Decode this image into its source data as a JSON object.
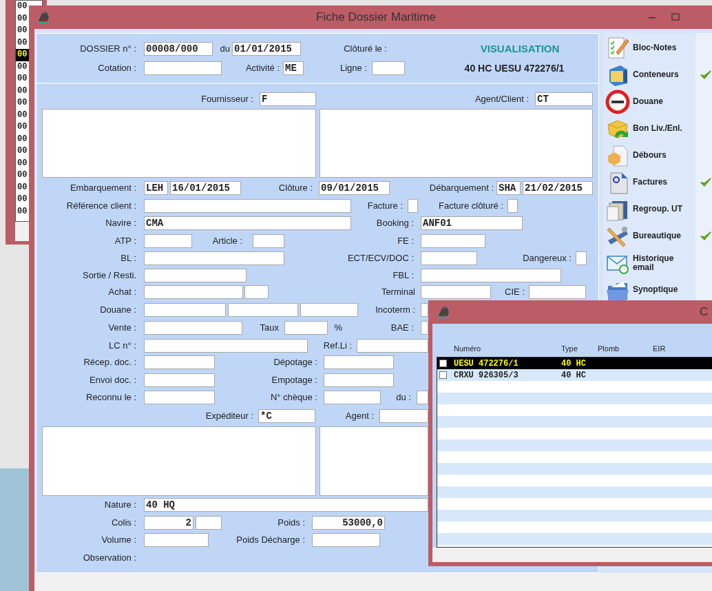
{
  "background_window": {
    "cells": [
      {
        "text": "00",
        "selected": false
      },
      {
        "text": "00",
        "selected": false
      },
      {
        "text": "00",
        "selected": false
      },
      {
        "text": "00",
        "selected": false
      },
      {
        "text": "00",
        "selected": true
      },
      {
        "text": "00",
        "selected": false
      },
      {
        "text": "00",
        "selected": false
      },
      {
        "text": "00",
        "selected": false
      },
      {
        "text": "00",
        "selected": false
      },
      {
        "text": "00",
        "selected": false
      },
      {
        "text": "00",
        "selected": false
      },
      {
        "text": "00",
        "selected": false
      },
      {
        "text": "00",
        "selected": false
      },
      {
        "text": "00",
        "selected": false
      },
      {
        "text": "00",
        "selected": false
      },
      {
        "text": "00",
        "selected": false
      },
      {
        "text": "00",
        "selected": false
      },
      {
        "text": "00",
        "selected": false
      }
    ]
  },
  "window": {
    "title": "Fiche Dossier Maritime"
  },
  "form_rows": [
    {
      "items": [
        {
          "kind": "label",
          "text": "DOSSIER n° :"
        },
        {
          "kind": "field",
          "value": "00008/000"
        },
        {
          "kind": "label",
          "text": "du"
        },
        {
          "kind": "field",
          "value": "01/01/2015"
        },
        {
          "kind": "label",
          "text": "Clôturé le :"
        },
        {
          "kind": "status",
          "text": "VISUALISATION"
        }
      ]
    },
    {
      "items": [
        {
          "kind": "label",
          "text": "Cotation :"
        },
        {
          "kind": "field"
        },
        {
          "kind": "label",
          "text": "Activité :"
        },
        {
          "kind": "field",
          "value": "ME"
        },
        {
          "kind": "label",
          "text": "Ligne :"
        },
        {
          "kind": "field"
        },
        {
          "kind": "heading",
          "text": "40 HC UESU 472276/1"
        }
      ]
    },
    {
      "items": [
        {
          "kind": "label",
          "text": "Fournisseur :"
        },
        {
          "kind": "field",
          "value": "F"
        },
        {
          "kind": "label",
          "text": "Agent/Client :"
        },
        {
          "kind": "field",
          "value": "CT"
        }
      ]
    },
    {
      "items": [
        {
          "kind": "textarea"
        },
        {
          "kind": "textarea"
        }
      ]
    },
    {
      "items": [
        {
          "kind": "label",
          "text": "Embarquement :"
        },
        {
          "kind": "field",
          "value": "LEH"
        },
        {
          "kind": "field",
          "value": "16/01/2015"
        },
        {
          "kind": "label",
          "text": "Clôture :"
        },
        {
          "kind": "field",
          "value": "09/01/2015"
        },
        {
          "kind": "label",
          "text": "Débarquement :"
        },
        {
          "kind": "field",
          "value": "SHA"
        },
        {
          "kind": "field",
          "value": "21/02/2015"
        }
      ]
    },
    {
      "items": [
        {
          "kind": "label",
          "text": "Référence client :"
        },
        {
          "kind": "field"
        },
        {
          "kind": "label",
          "text": "Facture :"
        },
        {
          "kind": "checkbox",
          "checked": false
        },
        {
          "kind": "label",
          "text": "Facture clôturé :"
        },
        {
          "kind": "checkbox",
          "checked": false
        }
      ]
    },
    {
      "items": [
        {
          "kind": "label",
          "text": "Navire :"
        },
        {
          "kind": "field",
          "value": "CMA"
        },
        {
          "kind": "label",
          "text": "Booking :"
        },
        {
          "kind": "field",
          "value": "ANF01"
        }
      ]
    },
    {
      "items": [
        {
          "kind": "label",
          "text": "ATP :"
        },
        {
          "kind": "field"
        },
        {
          "kind": "label",
          "text": "Article :"
        },
        {
          "kind": "field"
        },
        {
          "kind": "label",
          "text": "FE :"
        },
        {
          "kind": "field"
        }
      ]
    },
    {
      "items": [
        {
          "kind": "label",
          "text": "BL :"
        },
        {
          "kind": "field"
        },
        {
          "kind": "label",
          "text": "ECT/ECV/DOC :"
        },
        {
          "kind": "field"
        },
        {
          "kind": "label",
          "text": "Dangereux :"
        },
        {
          "kind": "checkbox",
          "checked": false
        }
      ]
    },
    {
      "items": [
        {
          "kind": "label",
          "text": "Sortie / Resti."
        },
        {
          "kind": "field"
        },
        {
          "kind": "label",
          "text": "FBL :"
        },
        {
          "kind": "field"
        }
      ]
    },
    {
      "items": [
        {
          "kind": "label",
          "text": "Achat :"
        },
        {
          "kind": "field"
        },
        {
          "kind": "field"
        },
        {
          "kind": "label",
          "text": "Terminal"
        },
        {
          "kind": "field"
        },
        {
          "kind": "label",
          "text": "CIE :"
        },
        {
          "kind": "field"
        }
      ]
    },
    {
      "items": [
        {
          "kind": "label",
          "text": "Douane :"
        },
        {
          "kind": "field"
        },
        {
          "kind": "field"
        },
        {
          "kind": "field"
        },
        {
          "kind": "label",
          "text": "Incoterm :"
        },
        {
          "kind": "field"
        }
      ]
    },
    {
      "items": [
        {
          "kind": "label",
          "text": "Vente :"
        },
        {
          "kind": "field"
        },
        {
          "kind": "label",
          "text": "Taux"
        },
        {
          "kind": "field"
        },
        {
          "kind": "label",
          "text": "%"
        },
        {
          "kind": "label",
          "text": "BAE :"
        },
        {
          "kind": "field"
        }
      ]
    },
    {
      "items": [
        {
          "kind": "label",
          "text": "LC n° :"
        },
        {
          "kind": "field"
        },
        {
          "kind": "label",
          "text": "Ref.Li :"
        },
        {
          "kind": "field"
        }
      ]
    },
    {
      "items": [
        {
          "kind": "label",
          "text": "Récep. doc. :"
        },
        {
          "kind": "field"
        },
        {
          "kind": "label",
          "text": "Dépotage :"
        },
        {
          "kind": "field"
        }
      ]
    },
    {
      "items": [
        {
          "kind": "label",
          "text": "Envoi doc. :"
        },
        {
          "kind": "field"
        },
        {
          "kind": "label",
          "text": "Empotage :"
        },
        {
          "kind": "field"
        }
      ]
    },
    {
      "items": [
        {
          "kind": "label",
          "text": "Reconnu le :"
        },
        {
          "kind": "field"
        },
        {
          "kind": "label",
          "text": "N° chèque :"
        },
        {
          "kind": "field"
        },
        {
          "kind": "label",
          "text": "du :"
        },
        {
          "kind": "field"
        }
      ]
    },
    {
      "items": [
        {
          "kind": "label",
          "text": "Expéditeur :"
        },
        {
          "kind": "field",
          "value": "*C"
        },
        {
          "kind": "label",
          "text": "Agent :"
        },
        {
          "kind": "field"
        }
      ]
    },
    {
      "items": [
        {
          "kind": "textarea"
        },
        {
          "kind": "textarea"
        }
      ]
    },
    {
      "items": [
        {
          "kind": "label",
          "text": "Nature :"
        },
        {
          "kind": "field",
          "value": "40 HQ"
        }
      ]
    },
    {
      "items": [
        {
          "kind": "label",
          "text": "Colis :"
        },
        {
          "kind": "field",
          "value": "2"
        },
        {
          "kind": "field"
        },
        {
          "kind": "label",
          "text": "Poids :"
        },
        {
          "kind": "field",
          "value": "53000,0"
        }
      ]
    },
    {
      "items": [
        {
          "kind": "label",
          "text": "Volume :"
        },
        {
          "kind": "field"
        },
        {
          "kind": "label",
          "text": "Poids Décharge :"
        },
        {
          "kind": "field"
        }
      ]
    },
    {
      "items": [
        {
          "kind": "label",
          "text": "Observation :"
        }
      ]
    }
  ],
  "sidebar": {
    "items": [
      {
        "label": "Bloc-Notes",
        "done": false
      },
      {
        "label": "Conteneurs",
        "done": true
      },
      {
        "label": "Douane",
        "done": false
      },
      {
        "label": "Bon Liv./Enl.",
        "done": false
      },
      {
        "label": "Débours",
        "done": false
      },
      {
        "label": "Factures",
        "done": true
      },
      {
        "label": "Regroup. UT",
        "done": false
      },
      {
        "label": "Bureautique",
        "done": true
      },
      {
        "label": "Historique email",
        "done": false
      },
      {
        "label": "Synoptique",
        "done": false
      }
    ]
  },
  "containers_window": {
    "title": "C",
    "columns": [
      "Numéro",
      "Type",
      "Plomb",
      "EIR"
    ],
    "rows": [
      {
        "numero": "UESU 472276/1",
        "type": "40 HC",
        "checked": false,
        "selected": true
      },
      {
        "numero": "CRXU 926305/3",
        "type": "40 HC",
        "checked": false,
        "selected": false
      }
    ]
  }
}
